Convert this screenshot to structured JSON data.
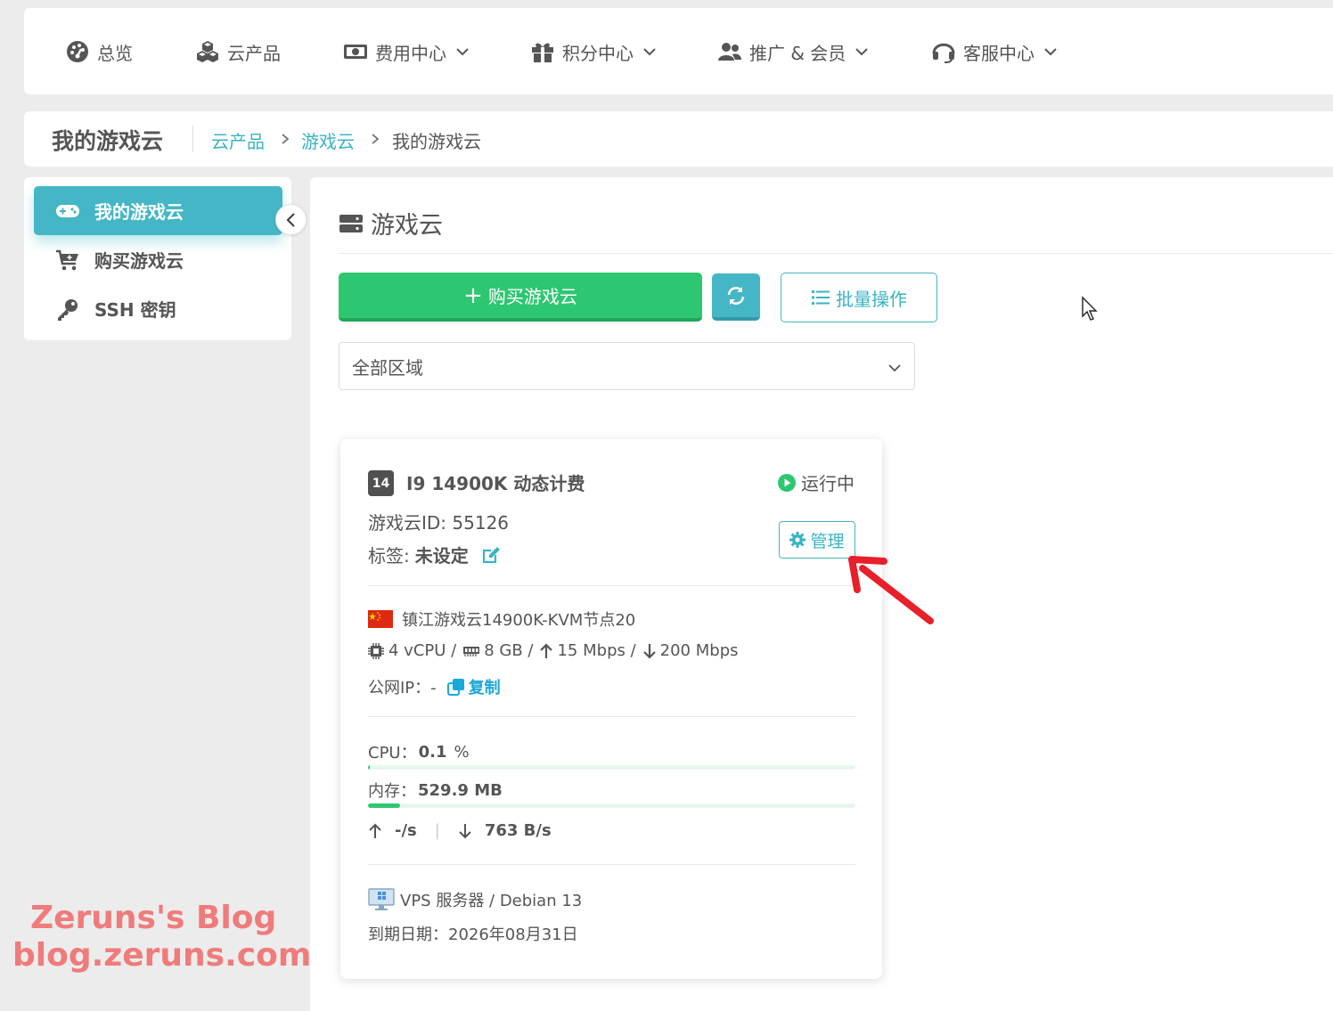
{
  "nav": {
    "items": [
      {
        "label": "总览",
        "icon": "dashboard-icon"
      },
      {
        "label": "云产品",
        "icon": "cubes-icon"
      },
      {
        "label": "费用中心",
        "icon": "money-icon"
      },
      {
        "label": "积分中心",
        "icon": "gift-icon"
      },
      {
        "label": "推广 & 会员",
        "icon": "users-icon"
      },
      {
        "label": "客服中心",
        "icon": "headset-icon"
      }
    ]
  },
  "breadcrumb": {
    "title": "我的游戏云",
    "items": [
      "云产品",
      "游戏云",
      "我的游戏云"
    ]
  },
  "sidebar": {
    "items": [
      {
        "label": "我的游戏云",
        "icon": "gamepad-icon",
        "active": true
      },
      {
        "label": "购买游戏云",
        "icon": "cart-icon",
        "active": false
      },
      {
        "label": "SSH 密钥",
        "icon": "key-icon",
        "active": false
      }
    ]
  },
  "main": {
    "title": "游戏云",
    "buy_label": "购买游戏云",
    "batch_label": "批量操作",
    "region_select": "全部区域"
  },
  "card": {
    "badge": "14",
    "name": "I9 14900K 动态计费",
    "status": "运行中",
    "id_text": "游戏云ID: 55126",
    "tag_label": "标签:",
    "tag_value": "未设定",
    "manage_label": "管理",
    "node": "镇江游戏云14900K-KVM节点20",
    "cpu_spec": "4 vCPU /",
    "ram_spec": "8 GB /",
    "up_bw": "15 Mbps /",
    "down_bw": "200 Mbps",
    "ip_label": "公网IP：-",
    "copy_label": "复制",
    "cpu_label": "CPU：",
    "cpu_value": "0.1",
    "cpu_unit": "%",
    "cpu_fraction": 0.001,
    "mem_label": "内存：",
    "mem_value": "529.9 MB",
    "mem_fraction": 0.065,
    "net_up": "-/s",
    "net_sep": "|",
    "net_down": "763 B/s",
    "os": "VPS 服务器 / Debian 13",
    "expiry": "到期日期：2026年08月31日"
  },
  "watermark": {
    "line1": "Zeruns's Blog",
    "line2": "blog.zeruns.com"
  },
  "colors": {
    "accent": "#44b6c6",
    "success": "#2ec771",
    "annotation": "#e8202a",
    "watermark": "#f07b7b"
  }
}
